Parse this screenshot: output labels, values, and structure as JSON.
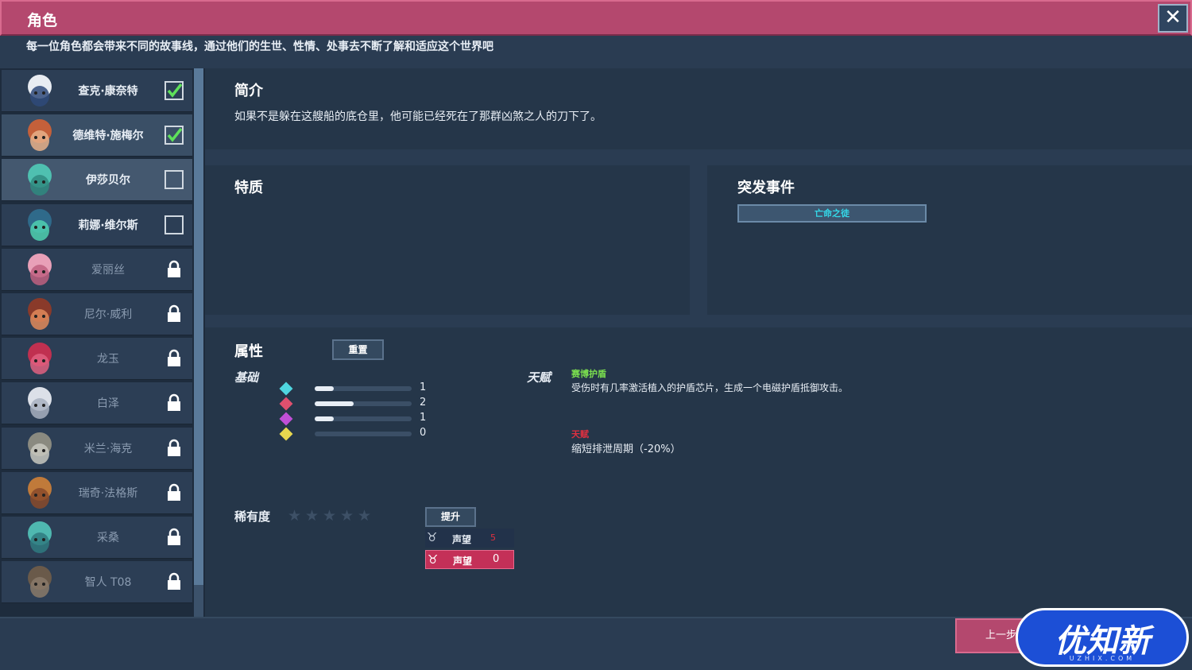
{
  "window": {
    "title": "角色",
    "subtitle": "每一位角色都会带来不同的故事线，通过他们的生世、性情、处事去不断了解和适应这个世界吧",
    "close_label": "✕"
  },
  "characters": [
    {
      "name": "查克·康奈特",
      "state": "checked"
    },
    {
      "name": "德维特·施梅尔",
      "state": "checked"
    },
    {
      "name": "伊莎贝尔",
      "state": "unchecked"
    },
    {
      "name": "莉娜·维尔斯",
      "state": "unchecked"
    },
    {
      "name": "爱丽丝",
      "state": "locked"
    },
    {
      "name": "尼尔·威利",
      "state": "locked"
    },
    {
      "name": "龙玉",
      "state": "locked"
    },
    {
      "name": "白泽",
      "state": "locked"
    },
    {
      "name": "米兰·海克",
      "state": "locked"
    },
    {
      "name": "瑞奇·法格斯",
      "state": "locked"
    },
    {
      "name": "采桑",
      "state": "locked"
    },
    {
      "name": "智人 T08",
      "state": "locked"
    }
  ],
  "intro": {
    "heading": "简介",
    "text": "如果不是躲在这艘船的底仓里，他可能已经死在了那群凶煞之人的刀下了。"
  },
  "traits": {
    "heading": "特质"
  },
  "events": {
    "heading": "突发事件",
    "event_button": "亡命之徒"
  },
  "attributes": {
    "heading": "属性",
    "reset_label": "重置",
    "base_label": "基础",
    "stats": [
      {
        "icon": "sword-icon",
        "color": "#4fd6e0",
        "value": 1,
        "fill": 0.2
      },
      {
        "icon": "fist-icon",
        "color": "#e0506e",
        "value": 2,
        "fill": 0.4
      },
      {
        "icon": "brain-icon",
        "color": "#c04fd6",
        "value": 1,
        "fill": 0.2
      },
      {
        "icon": "sparkle-icon",
        "color": "#e8d84f",
        "value": 0,
        "fill": 0
      }
    ],
    "talent_label": "天赋",
    "talent_name": "赛博护盾",
    "talent_desc": "受伤时有几率激活植入的护盾芯片，生成一个电磁护盾抵御攻击。",
    "debuff_name": "天赋",
    "debuff_desc": "缩短排泄周期（-20%）",
    "rarity_label": "稀有度",
    "rarity_stars": 5,
    "rarity_filled": 0,
    "upgrade_label": "提升",
    "reputation": [
      {
        "label": "声望",
        "value": "5"
      },
      {
        "label": "声望",
        "value": "0"
      }
    ]
  },
  "footer": {
    "prev_label": "上一步"
  },
  "watermark": {
    "text": "优知新",
    "sub": "UZHIX.COM"
  },
  "colors": {
    "titlebar": "#b4486e",
    "panel": "#253649",
    "talent": "#7be04f",
    "debuff": "#e03040",
    "event_text": "#34d8e8"
  }
}
